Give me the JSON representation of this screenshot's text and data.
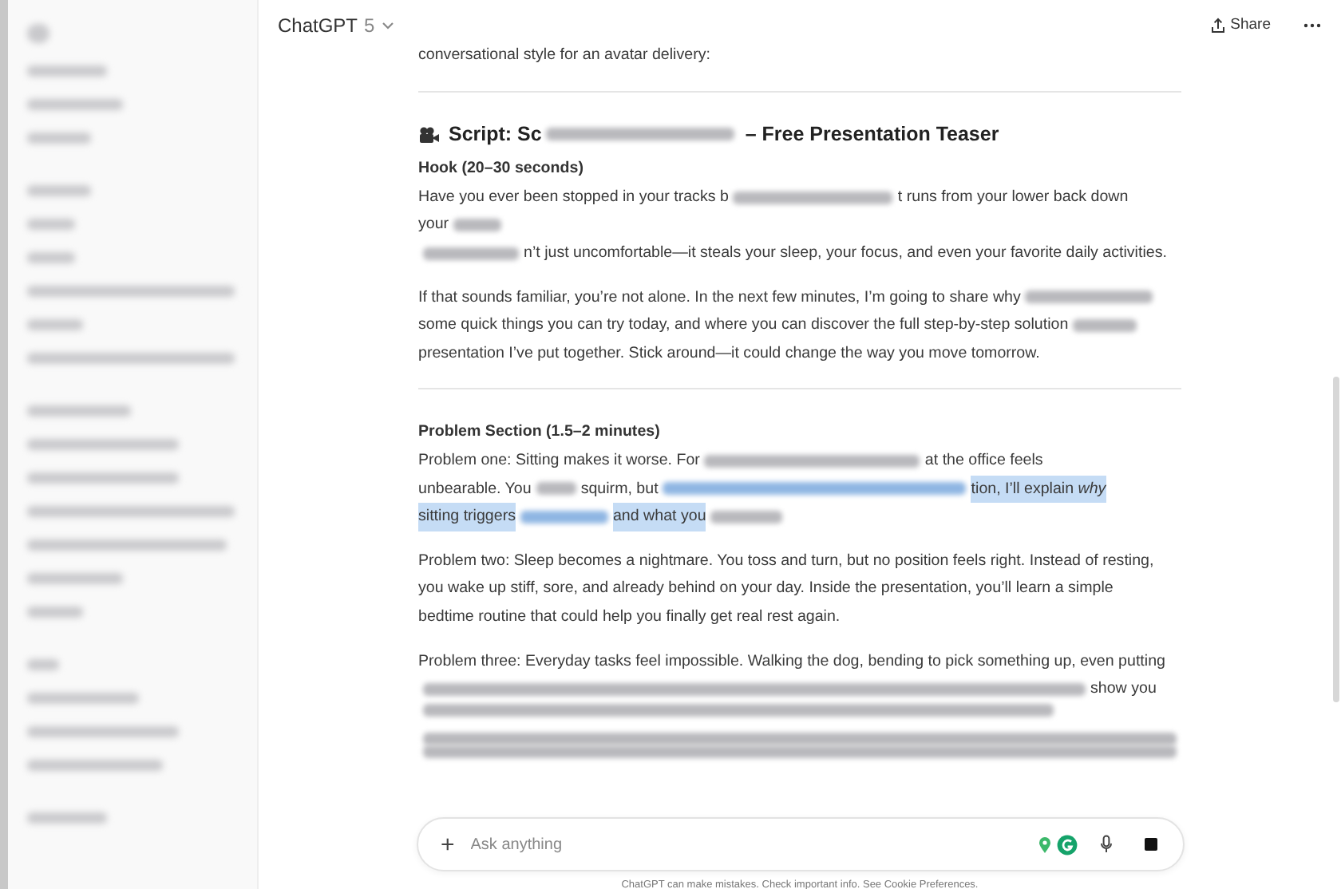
{
  "header": {
    "model": "ChatGPT",
    "version": "5",
    "share": "Share"
  },
  "blocks": [
    {
      "kind": "para",
      "lines": [
        [
          {
            "kind": "text",
            "text": "conversational style for an avatar delivery:"
          }
        ]
      ]
    },
    {
      "kind": "divider"
    },
    {
      "kind": "heading",
      "lines": [
        [
          {
            "kind": "text",
            "text": "Script: Sc"
          },
          {
            "kind": "redacted"
          },
          {
            "kind": "text",
            "text": " – Free Presentation Teaser"
          }
        ]
      ]
    },
    {
      "kind": "subheading",
      "lines": [
        [
          {
            "kind": "text",
            "text": "Hook (20–30 seconds)"
          }
        ]
      ]
    },
    {
      "kind": "para",
      "lines": [
        [
          {
            "kind": "text",
            "text": "Have you ever been stopped in your tracks b"
          },
          {
            "kind": "redacted"
          },
          {
            "kind": "text",
            "text": "t runs from your lower back down"
          }
        ],
        [
          {
            "kind": "text",
            "text": "your"
          },
          {
            "kind": "redacted"
          }
        ],
        [
          {
            "kind": "redacted"
          },
          {
            "kind": "text",
            "text": "n’t just uncomfortable—it steals your sleep, your focus, and even your favorite daily activities."
          }
        ]
      ]
    },
    {
      "kind": "para",
      "lines": [
        [
          {
            "kind": "text",
            "text": "If that sounds familiar, you’re not alone. In the next few minutes, I’m going to share why"
          },
          {
            "kind": "redacted"
          }
        ],
        [
          {
            "kind": "text",
            "text": "some quick things you can try today, and where you can discover the full step-by-step solution"
          },
          {
            "kind": "redacted"
          }
        ],
        [
          {
            "kind": "text",
            "text": "presentation I’ve put together. Stick around—it could change the way you move tomorrow."
          }
        ]
      ]
    },
    {
      "kind": "divider"
    },
    {
      "kind": "subheading",
      "lines": [
        [
          {
            "kind": "text",
            "text": "Problem Section (1.5–2 minutes)"
          }
        ]
      ]
    },
    {
      "kind": "para",
      "lines": [
        [
          {
            "kind": "text",
            "text": "Problem one: Sitting makes it worse. For"
          },
          {
            "kind": "redacted"
          },
          {
            "kind": "text",
            "text": "at the office feels"
          }
        ],
        [
          {
            "kind": "text",
            "text": "unbearable. You"
          },
          {
            "kind": "redacted"
          },
          {
            "kind": "text",
            "text": "squirm, but"
          },
          {
            "kind": "redacted",
            "selected": true
          },
          {
            "kind": "text",
            "text": "tion, I’ll explain *why*",
            "selected": true
          }
        ],
        [
          {
            "kind": "text",
            "text": "sitting triggers",
            "selected": true
          },
          {
            "kind": "redacted",
            "selected": true
          },
          {
            "kind": "text",
            "text": "and what you",
            "selected": true
          },
          {
            "kind": "redacted"
          }
        ]
      ]
    },
    {
      "kind": "para",
      "lines": [
        [
          {
            "kind": "text",
            "text": "Problem two: Sleep becomes a nightmare. You toss and turn, but no position feels right. Instead of resting,"
          }
        ],
        [
          {
            "kind": "text",
            "text": "you wake up stiff, sore, and already behind on your day. Inside the presentation, you’ll learn a simple"
          }
        ],
        [
          {
            "kind": "text",
            "text": "bedtime routine that could help you finally get real rest again."
          }
        ]
      ]
    },
    {
      "kind": "para",
      "lines": [
        [
          {
            "kind": "text",
            "text": "Problem three: Everyday tasks feel impossible. Walking the dog, bending to pick something up, even putting"
          }
        ],
        [
          {
            "kind": "redacted"
          },
          {
            "kind": "text",
            "text": "show you"
          }
        ],
        [
          {
            "kind": "redacted"
          }
        ]
      ]
    },
    {
      "kind": "para",
      "lines": [
        [
          {
            "kind": "redacted"
          }
        ],
        [
          {
            "kind": "redacted"
          }
        ]
      ]
    }
  ],
  "composer": {
    "placeholder": "Ask anything",
    "plus": "+"
  },
  "footer": "ChatGPT can make mistakes. Check important info. See Cookie Preferences."
}
